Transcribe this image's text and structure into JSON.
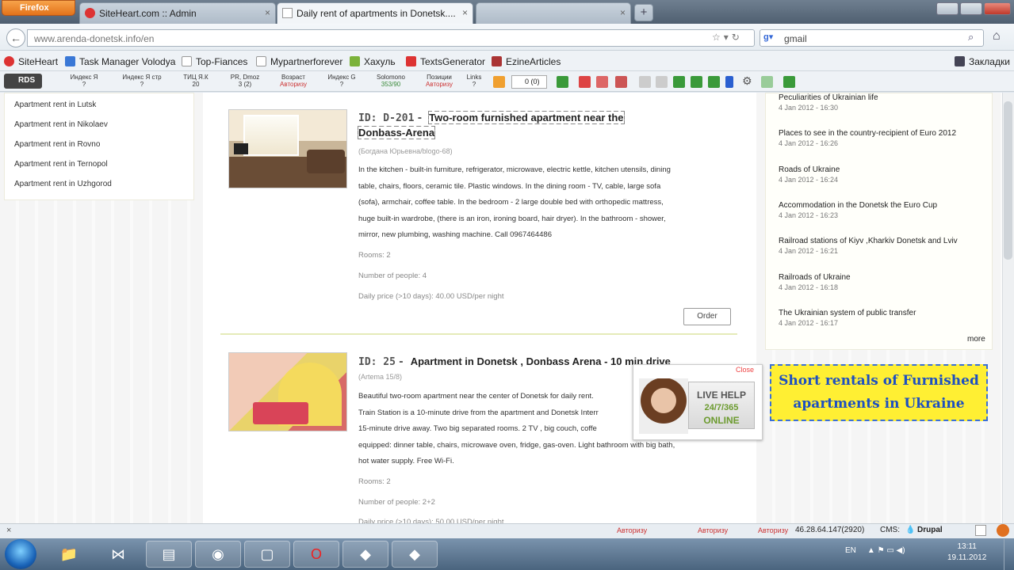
{
  "browser": {
    "menu_label": "Firefox",
    "tabs": [
      {
        "title": "SiteHeart.com :: Admin",
        "close": "×"
      },
      {
        "title": "Daily rent of apartments in Donetsk....",
        "close": "×"
      },
      {
        "title": "",
        "close": "×"
      }
    ],
    "new_tab": "+",
    "url": "www.arenda-donetsk.info/en",
    "search_value": "gmail",
    "search_engine_icon": "google-icon",
    "bookmarks": [
      {
        "label": "SiteHeart",
        "color": "#d33"
      },
      {
        "label": "Task Manager Volodya",
        "color": "#3a78d6"
      },
      {
        "label": "Top-Fiances",
        "color": "#ffffff"
      },
      {
        "label": "Mypartnerforever",
        "color": "#ffffff"
      },
      {
        "label": "Хахуль",
        "color": "#7bb23a"
      },
      {
        "label": "TextsGenerator",
        "color": "#d33"
      },
      {
        "label": "EzineArticles",
        "color": "#a33"
      }
    ],
    "bookmarks_right": "Закладки"
  },
  "rds": {
    "label": "RDS",
    "metrics": [
      {
        "name": "Индекс Я",
        "value": "?"
      },
      {
        "name": "Индекс Я стр",
        "value": "?"
      },
      {
        "name": "ТИЦ Я.К",
        "value": "20"
      },
      {
        "name": "PR, Dmoz",
        "value": "3 (2)"
      },
      {
        "name": "Возраст",
        "value": "Авторизу"
      },
      {
        "name": "Индекс G",
        "value": "?"
      },
      {
        "name": "Solomono",
        "value": "353/90"
      },
      {
        "name": "Позиции",
        "value": "Авторизу"
      },
      {
        "name": "Links",
        "value": "?"
      }
    ],
    "counter": "0 (0)"
  },
  "left_links": [
    "Apartment rent in Lutsk",
    "Apartment rent in Nikolaev",
    "Apartment rent in Rovno",
    "Apartment rent in Ternopol",
    "Apartment rent in Uzhgorod"
  ],
  "listings": [
    {
      "id": "ID: D-201",
      "title": "Two-room furnished apartment near the Donbass-Arena",
      "author": "(Богдана Юрьевна/blogo-68)",
      "description": [
        "In the kitchen - built-in furniture, refrigerator, microwave, electric kettle, kitchen utensils, dining",
        "table, chairs, floors, ceramic tile. Plastic windows. In the dining room - TV, cable, large sofa",
        "(sofa), armchair, coffee table. In the bedroom - 2 large double bed with orthopedic mattress,",
        "huge built-in wardrobe, (there is an iron, ironing board, hair dryer). In the bathroom - shower,",
        "mirror, new plumbing, washing machine. Call 0967464486"
      ],
      "rooms": "Rooms: 2",
      "people": "Number of people: 4",
      "price": "Daily price (>10 days): 40.00 USD/per night",
      "order": "Order"
    },
    {
      "id": "ID: 25",
      "title": "Apartment in Donetsk , Donbass Arena - 10 min drive",
      "author": "(Artema 15/8)",
      "description": [
        "Beautiful two-room apartment near the center of Donetsk for daily rent.",
        "Train Station is a 10-minute drive from the apartment and Donetsk Interr",
        "15-minute drive away. Two big separated rooms. 2 TV , big couch, coffe",
        "equipped: dinner table, chairs, microwave oven, fridge, gas-oven. Light bathroom with big bath,",
        "hot water supply. Free Wi-Fi."
      ],
      "rooms": "Rooms: 2",
      "people": "Number of people: 2+2",
      "price": "Daily price (>10 days): 50.00 USD/per night"
    }
  ],
  "news": [
    {
      "title": "Peculiarities of Ukrainian life",
      "date": "4 Jan 2012 - 16:30"
    },
    {
      "title": "Places to see in the country-recipient of Euro 2012",
      "date": "4 Jan 2012 - 16:26"
    },
    {
      "title": "Roads of Ukraine",
      "date": "4 Jan 2012 - 16:24"
    },
    {
      "title": "Accommodation in the Donetsk the Euro Cup",
      "date": "4 Jan 2012 - 16:23"
    },
    {
      "title": "Railroad stations of Kiyv ,Kharkiv Donetsk and Lviv",
      "date": "4 Jan 2012 - 16:21"
    },
    {
      "title": "Railroads of Ukraine",
      "date": "4 Jan 2012 - 16:18"
    },
    {
      "title": "The Ukrainian system of public transfer",
      "date": "4 Jan 2012 - 16:17"
    }
  ],
  "news_more": "more",
  "banner": {
    "line1": "Short rentals of Furnished",
    "line2": "apartments in Ukraine"
  },
  "live_help": {
    "close": "Close",
    "line1": "LIVE HELP",
    "line2": "24/7/365",
    "line3": "ONLINE"
  },
  "status": {
    "items": [
      "Авторизу",
      "Авторизу",
      "Авторизу"
    ],
    "ip": "46.28.64.147(2920)",
    "cms_label": "CMS:",
    "cms": "Drupal"
  },
  "taskbar": {
    "lang": "EN",
    "time": "13:11",
    "date": "19.11.2012"
  },
  "colors": {
    "accent": "#3a6fd6",
    "banner_bg": "#ffef33",
    "firefox": "#e3731a"
  }
}
